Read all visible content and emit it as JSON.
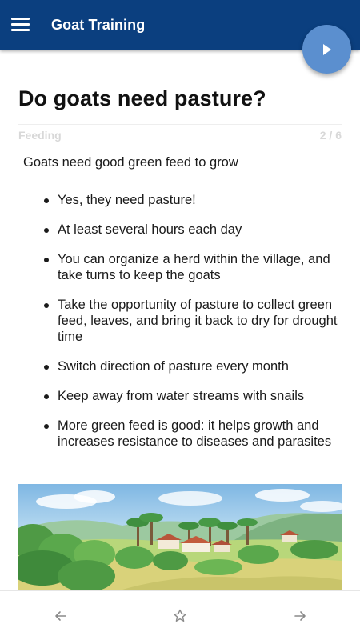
{
  "appbar": {
    "title": "Goat Training",
    "menu_icon": "hamburger-menu-icon",
    "background": "#0b3f7f"
  },
  "fab": {
    "icon": "play-icon",
    "color": "#5b8fcf"
  },
  "lesson": {
    "title": "Do goats need pasture?",
    "category": "Feeding",
    "progress": "2 / 6",
    "intro": "Goats need good green feed to grow",
    "bullets": [
      "Yes, they need pasture!",
      "At least several hours each day",
      "You can organize a herd within the village, and take turns to keep the goats",
      "Take the opportunity of pasture to collect green feed, leaves, and bring it back to dry for drought time",
      "Switch direction of pasture every month",
      "Keep away from water streams with snails",
      "More green feed is good: it helps growth and increases resistance to diseases and parasites"
    ]
  },
  "bottom_nav": {
    "prev_icon": "arrow-left-icon",
    "favorite_icon": "star-outline-icon",
    "next_icon": "arrow-right-icon"
  }
}
